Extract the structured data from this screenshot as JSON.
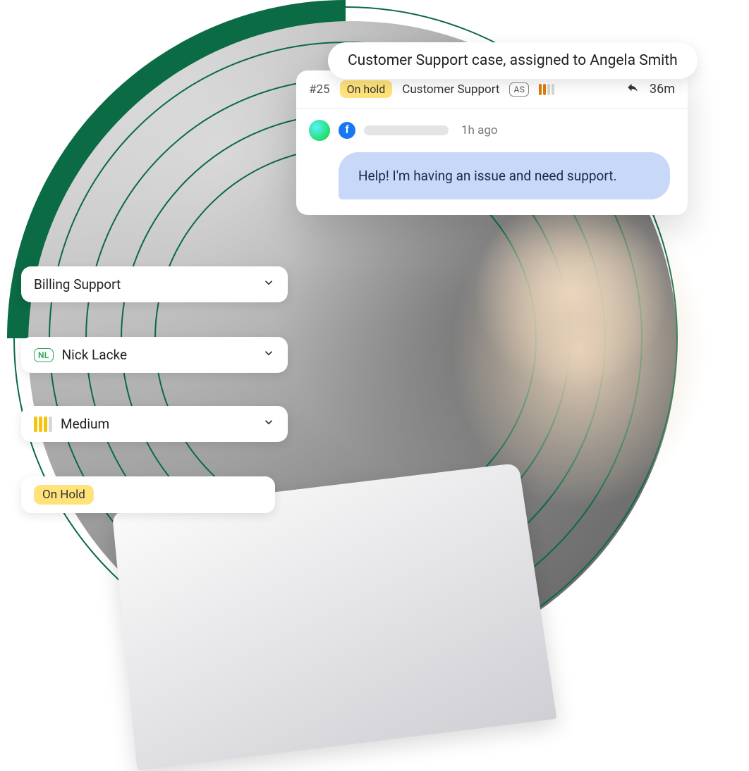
{
  "title_pill": "Customer Support case, assigned to Angela Smith",
  "case": {
    "id": "#25",
    "status": "On hold",
    "category": "Customer Support",
    "assignee_initials": "AS",
    "response_time": "36m",
    "message": {
      "source": "facebook",
      "time": "1h ago",
      "text": "Help! I'm having an issue and need support."
    }
  },
  "dropdowns": {
    "department": "Billing Support",
    "assignee": {
      "initials": "NL",
      "name": "Nick Lacke"
    },
    "priority": "Medium",
    "status": "On Hold"
  }
}
